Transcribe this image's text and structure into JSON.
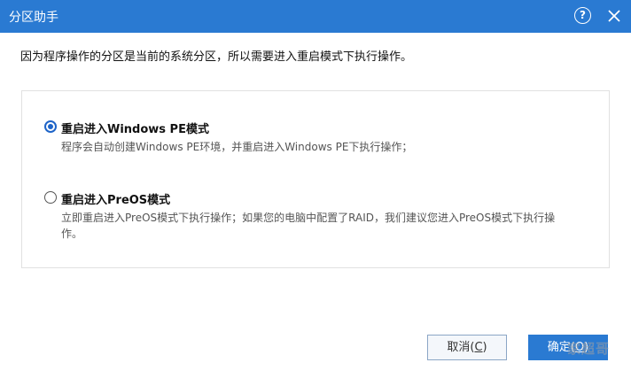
{
  "window": {
    "title": "分区助手"
  },
  "message": "因为程序操作的分区是当前的系统分区，所以需要进入重启模式下执行操作。",
  "options": [
    {
      "label": "重启进入Windows PE模式",
      "description": "程序会自动创建Windows PE环境，并重启进入Windows PE下执行操作；",
      "selected": true
    },
    {
      "label": "重启进入PreOS模式",
      "description": "立即重启进入PreOS模式下执行操作；如果您的电脑中配置了RAID，我们建议您进入PreOS模式下执行操作。",
      "selected": false
    }
  ],
  "buttons": {
    "cancel": {
      "label": "取消(",
      "hotkey": "C",
      "close": ")"
    },
    "ok": {
      "label": "确定(",
      "hotkey": "O",
      "close": ")"
    }
  },
  "watermark": "家超哥",
  "colors": {
    "accent": "#2a7ad2",
    "radio": "#1e64c8"
  }
}
